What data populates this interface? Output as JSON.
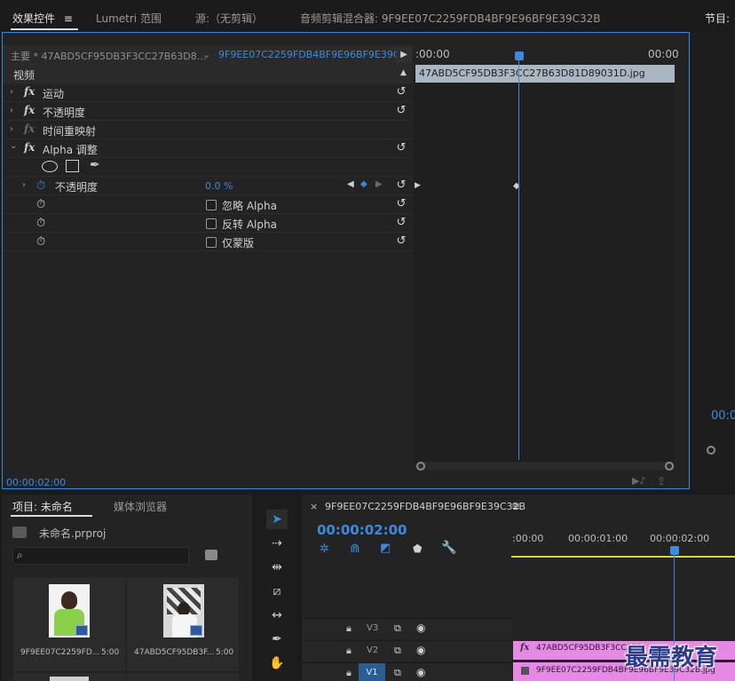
{
  "tabs": {
    "effect_controls": "效果控件",
    "menu_glyph": "≡",
    "lumetri": "Lumetri 范围",
    "source": "源:（无剪辑）",
    "audio_mixer": "音频剪辑混合器: 9F9EE07C2259FDB4BF9E96BF9E39C32B",
    "program": "节目:"
  },
  "effect_controls": {
    "master_label": "主要 * 47ABD5CF95DB3F3CC27B63D8...",
    "sequence_label": "9F9EE07C2259FDB4BF9E96BF9E39C...",
    "ruler_start": ":00:00",
    "ruler_end": "00:00",
    "clip_name": "47ABD5CF95DB3F3CC27B63D81D89031D.jpg",
    "section_video": "视频",
    "fx_glyph": "fx",
    "effects": [
      {
        "label": "运动"
      },
      {
        "label": "不透明度"
      },
      {
        "label": "时间重映射"
      },
      {
        "label": "Alpha 调整"
      }
    ],
    "opacity_label": "不透明度",
    "opacity_value": "0.0 %",
    "ignore_alpha": "忽略 Alpha",
    "invert_alpha": "反转 Alpha",
    "mask_only": "仅蒙版",
    "timecode": "00:00:02:00",
    "colors": {
      "accent": "#2d8ceb",
      "clip": "#aab6c2",
      "playhead": "#3a8be0"
    }
  },
  "program": {
    "timecode": "00:0"
  },
  "project": {
    "tab_label": "项目: 未命名",
    "media_browser": "媒体浏览器",
    "file_name": "未命名.prproj",
    "items": [
      {
        "name": "9F9EE07C2259FD...",
        "duration": "5:00"
      },
      {
        "name": "47ABD5CF95DB3F...",
        "duration": "5:00"
      }
    ]
  },
  "sequence": {
    "close_glyph": "×",
    "title": "9F9EE07C2259FDB4BF9E96BF9E39C32B",
    "menu_glyph": "≡",
    "timecode": "00:00:02:00",
    "ruler": [
      ":00:00",
      "00:00:01:00",
      "00:00:02:00"
    ],
    "tracks": [
      {
        "name": "V3"
      },
      {
        "name": "V2",
        "clip": "47ABD5CF95DB3F3CC27B"
      },
      {
        "name": "V1",
        "clip": "9F9EE07C2259FDB4BF9E96BF9E39C32B.jpg"
      }
    ],
    "colors": {
      "clip": "#e48ae4",
      "work_area": "#d7d733"
    }
  },
  "watermark": "最需教育"
}
